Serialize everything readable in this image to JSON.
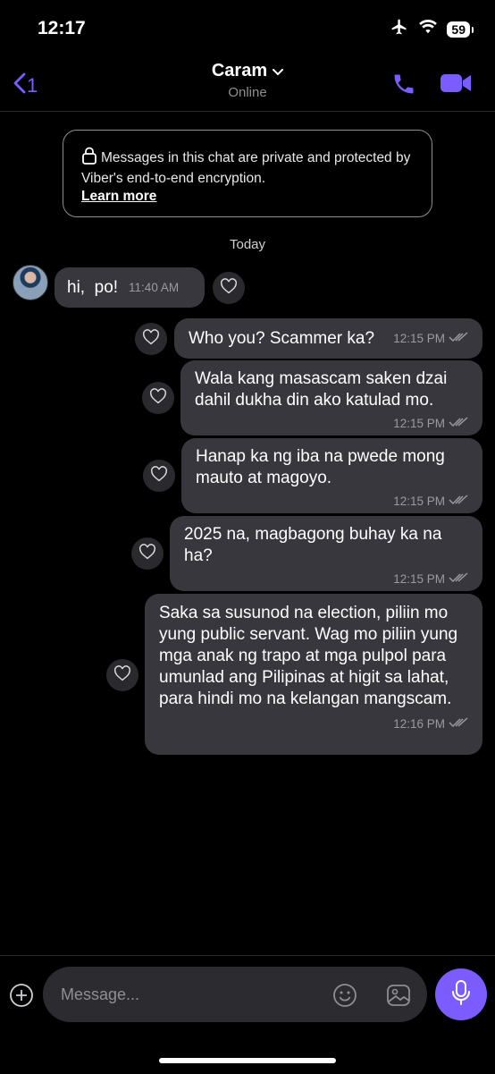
{
  "status": {
    "time": "12:17",
    "battery": "59"
  },
  "header": {
    "back_count": "1",
    "contact_name": "Caram",
    "status": "Online"
  },
  "notice": {
    "text": "Messages in this chat are private and protected by Viber's end-to-end encryption.",
    "link": "Learn more"
  },
  "date_label": "Today",
  "messages": [
    {
      "direction": "incoming",
      "text": "hi,  po!",
      "time": "11:40 AM"
    },
    {
      "direction": "outgoing",
      "text": "Who you? Scammer ka?",
      "time": "12:15 PM"
    },
    {
      "direction": "outgoing",
      "text": "Wala kang masascam saken dzai dahil dukha din ako katulad mo.",
      "time": "12:15 PM"
    },
    {
      "direction": "outgoing",
      "text": "Hanap ka ng iba na pwede mong mauto at magoyo.",
      "time": "12:15 PM"
    },
    {
      "direction": "outgoing",
      "text": "2025 na, magbagong buhay ka na ha?",
      "time": "12:15 PM"
    },
    {
      "direction": "outgoing",
      "text": "Saka sa susunod na election, piliin mo yung public servant. Wag mo piliin yung mga anak ng trapo at mga pulpol para umunlad ang Pilipinas at higit sa lahat, para hindi mo na kelangan mangscam.",
      "time": "12:16 PM"
    }
  ],
  "composer": {
    "placeholder": "Message..."
  },
  "colors": {
    "accent": "#7b5cff",
    "bubble": "#37373d",
    "background": "#000000"
  },
  "icons": [
    "airplane-icon",
    "wifi-icon",
    "battery-icon",
    "back-chevron-icon",
    "chevron-down-icon",
    "phone-icon",
    "video-icon",
    "lock-icon",
    "heart-icon",
    "read-receipt-icon",
    "plus-icon",
    "emoji-icon",
    "gallery-icon",
    "mic-icon"
  ]
}
